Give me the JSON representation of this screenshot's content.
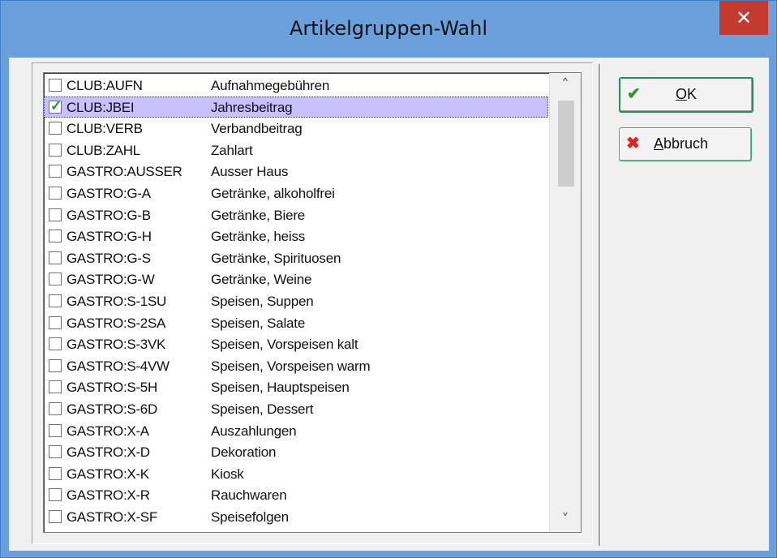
{
  "window": {
    "title": "Artikelgruppen-Wahl",
    "close_symbol": "✕"
  },
  "list": {
    "items": [
      {
        "code": "CLUB:AUFN",
        "desc": "Aufnahmegebühren",
        "checked": false,
        "selected": false
      },
      {
        "code": "CLUB:JBEI",
        "desc": "Jahresbeitrag",
        "checked": true,
        "selected": true
      },
      {
        "code": "CLUB:VERB",
        "desc": "Verbandbeitrag",
        "checked": false,
        "selected": false
      },
      {
        "code": "CLUB:ZAHL",
        "desc": "Zahlart",
        "checked": false,
        "selected": false
      },
      {
        "code": "GASTRO:AUSSER",
        "desc": "Ausser Haus",
        "checked": false,
        "selected": false
      },
      {
        "code": "GASTRO:G-A",
        "desc": "Getränke, alkoholfrei",
        "checked": false,
        "selected": false
      },
      {
        "code": "GASTRO:G-B",
        "desc": "Getränke, Biere",
        "checked": false,
        "selected": false
      },
      {
        "code": "GASTRO:G-H",
        "desc": "Getränke, heiss",
        "checked": false,
        "selected": false
      },
      {
        "code": "GASTRO:G-S",
        "desc": "Getränke, Spirituosen",
        "checked": false,
        "selected": false
      },
      {
        "code": "GASTRO:G-W",
        "desc": "Getränke, Weine",
        "checked": false,
        "selected": false
      },
      {
        "code": "GASTRO:S-1SU",
        "desc": "Speisen, Suppen",
        "checked": false,
        "selected": false
      },
      {
        "code": "GASTRO:S-2SA",
        "desc": "Speisen, Salate",
        "checked": false,
        "selected": false
      },
      {
        "code": "GASTRO:S-3VK",
        "desc": "Speisen, Vorspeisen kalt",
        "checked": false,
        "selected": false
      },
      {
        "code": "GASTRO:S-4VW",
        "desc": "Speisen, Vorspeisen warm",
        "checked": false,
        "selected": false
      },
      {
        "code": "GASTRO:S-5H",
        "desc": "Speisen, Hauptspeisen",
        "checked": false,
        "selected": false
      },
      {
        "code": "GASTRO:S-6D",
        "desc": "Speisen, Dessert",
        "checked": false,
        "selected": false
      },
      {
        "code": "GASTRO:X-A",
        "desc": "Auszahlungen",
        "checked": false,
        "selected": false
      },
      {
        "code": "GASTRO:X-D",
        "desc": "Dekoration",
        "checked": false,
        "selected": false
      },
      {
        "code": "GASTRO:X-K",
        "desc": "Kiosk",
        "checked": false,
        "selected": false
      },
      {
        "code": "GASTRO:X-R",
        "desc": "Rauchwaren",
        "checked": false,
        "selected": false
      },
      {
        "code": "GASTRO:X-SF",
        "desc": "Speisefolgen",
        "checked": false,
        "selected": false
      }
    ]
  },
  "scrollbar": {
    "up_symbol": "˄",
    "down_symbol": "˅"
  },
  "buttons": {
    "ok": {
      "mnemonic": "O",
      "rest": "K",
      "icon": "check-icon"
    },
    "cancel": {
      "mnemonic": "A",
      "rest": "bbruch",
      "icon": "x-icon"
    }
  },
  "colors": {
    "title_bg": "#6aa1dc",
    "close_bg": "#c6392f",
    "selection_bg": "#c8c0ff",
    "check_green": "#1f9a25",
    "cancel_red": "#e2221b"
  }
}
